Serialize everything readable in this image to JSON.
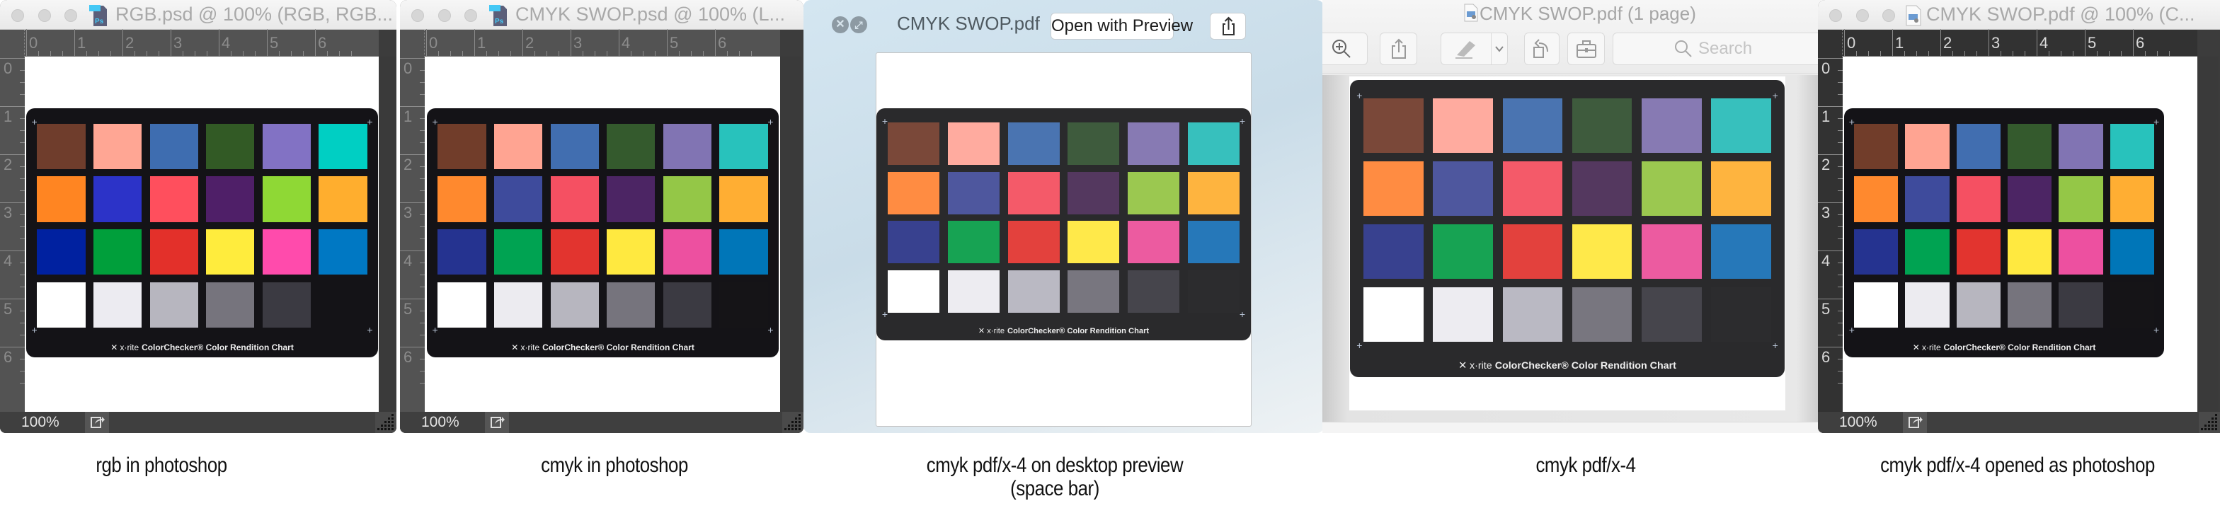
{
  "windows": {
    "ps_rgb": {
      "title": "RGB.psd @ 100% (RGB, RGB...",
      "zoom": "100%",
      "ruler_top_labels": [
        "0",
        "1",
        "2",
        "3",
        "4",
        "5",
        "6"
      ],
      "ruler_left_labels": [
        "0",
        "1",
        "2",
        "3",
        "4",
        "5",
        "6"
      ]
    },
    "ps_cmyk": {
      "title": "CMYK SWOP.psd @ 100% (L...",
      "zoom": "100%",
      "ruler_top_labels": [
        "0",
        "1",
        "2",
        "3",
        "4",
        "5",
        "6"
      ],
      "ruler_left_labels": [
        "0",
        "1",
        "2",
        "3",
        "4",
        "5",
        "6"
      ]
    },
    "quicklook": {
      "title": "CMYK SWOP.pdf",
      "open_button": "Open with Preview",
      "close_glyph": "✕",
      "fullscreen_glyph": "⤢"
    },
    "preview": {
      "title": "CMYK SWOP.pdf (1 page)",
      "title_chevron": "⌄",
      "search_placeholder": "Search",
      "toolbar": [
        "zoom-in",
        "share",
        "markup",
        "markup-menu",
        "rotate",
        "toolbox"
      ]
    },
    "ps_pdf": {
      "title": "CMYK SWOP.pdf @ 100% (C...",
      "zoom": "100%",
      "ruler_top_labels": [
        "0",
        "1",
        "2",
        "3",
        "4",
        "5",
        "6"
      ],
      "ruler_left_labels": [
        "0",
        "1",
        "2",
        "3",
        "4",
        "5",
        "6"
      ]
    }
  },
  "chart_caption": {
    "brand": "x·rite",
    "text": "ColorChecker® Color Rendition Chart"
  },
  "swatches": {
    "rgb": [
      "#6f3d2c",
      "#ffa694",
      "#3e6db0",
      "#325a25",
      "#8272c4",
      "#00cfc3",
      "#ff8522",
      "#2c33c8",
      "#ff4f5d",
      "#4f1f68",
      "#8fd835",
      "#ffae2e",
      "#0021a0",
      "#009f3b",
      "#e3302a",
      "#ffec3d",
      "#ff4bac",
      "#0078c3",
      "#ffffff",
      "#ecebf1",
      "#b7b6bf",
      "#76747d",
      "#3b3a42",
      "#141317"
    ],
    "cmyk": [
      "#713d2a",
      "#ffa492",
      "#416eb0",
      "#345a2d",
      "#8174b3",
      "#28c2bc",
      "#ff892e",
      "#3e4b9c",
      "#f55062",
      "#4c2564",
      "#94c747",
      "#ffae33",
      "#253390",
      "#00a352",
      "#e2342f",
      "#ffe940",
      "#ed50a0",
      "#0076b8",
      "#ffffff",
      "#ecebf0",
      "#b7b6bf",
      "#76747d",
      "#3b3a42",
      "#151417"
    ],
    "pdf": [
      "#7a4839",
      "#ffab9f",
      "#4a74b1",
      "#3e5b3d",
      "#877ab3",
      "#37c0bd",
      "#ff8c42",
      "#4e579e",
      "#f45a69",
      "#54385f",
      "#9bc850",
      "#feb43f",
      "#38418f",
      "#17a353",
      "#e3413d",
      "#ffe94a",
      "#ec5ba0",
      "#2678b9",
      "#ffffff",
      "#edecf1",
      "#bab9c3",
      "#78767f",
      "#46454c",
      "#2c2c2e"
    ]
  },
  "captions": [
    "rgb in photoshop",
    "cmyk in photoshop",
    "cmyk pdf/x-4 on desktop preview",
    "(space bar)",
    "cmyk pdf/x-4",
    "cmyk pdf/x-4 opened as photoshop"
  ]
}
